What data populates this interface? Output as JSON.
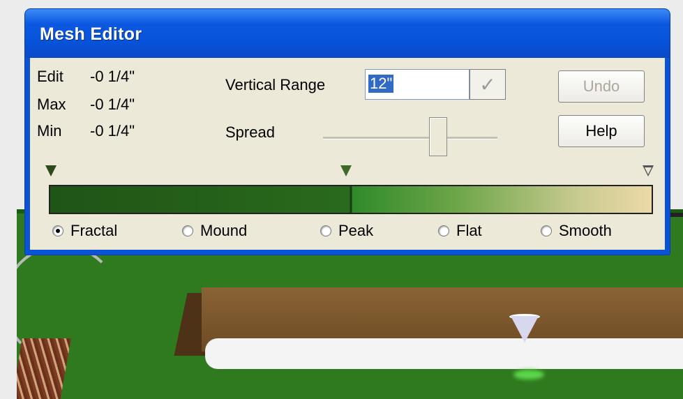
{
  "window": {
    "title": "Mesh Editor"
  },
  "stats": {
    "edit_label": "Edit",
    "edit_value": "-0 1/4\"",
    "max_label": "Max",
    "max_value": "-0 1/4\"",
    "min_label": "Min",
    "min_value": "-0 1/4\""
  },
  "vertical_range": {
    "label": "Vertical Range",
    "value": "12\"",
    "confirm_icon": "checkmark-icon"
  },
  "spread": {
    "label": "Spread",
    "level": 0.66
  },
  "buttons": {
    "undo": "Undo",
    "help": "Help",
    "undo_disabled": true
  },
  "gradient": {
    "left_color": "#2a6a1d",
    "mid_color": "#2f8a2a",
    "right_color": "#ecd9a8"
  },
  "modes": [
    {
      "label": "Fractal",
      "selected": true
    },
    {
      "label": "Mound",
      "selected": false
    },
    {
      "label": "Peak",
      "selected": false
    },
    {
      "label": "Flat",
      "selected": false
    },
    {
      "label": "Smooth",
      "selected": false
    }
  ]
}
